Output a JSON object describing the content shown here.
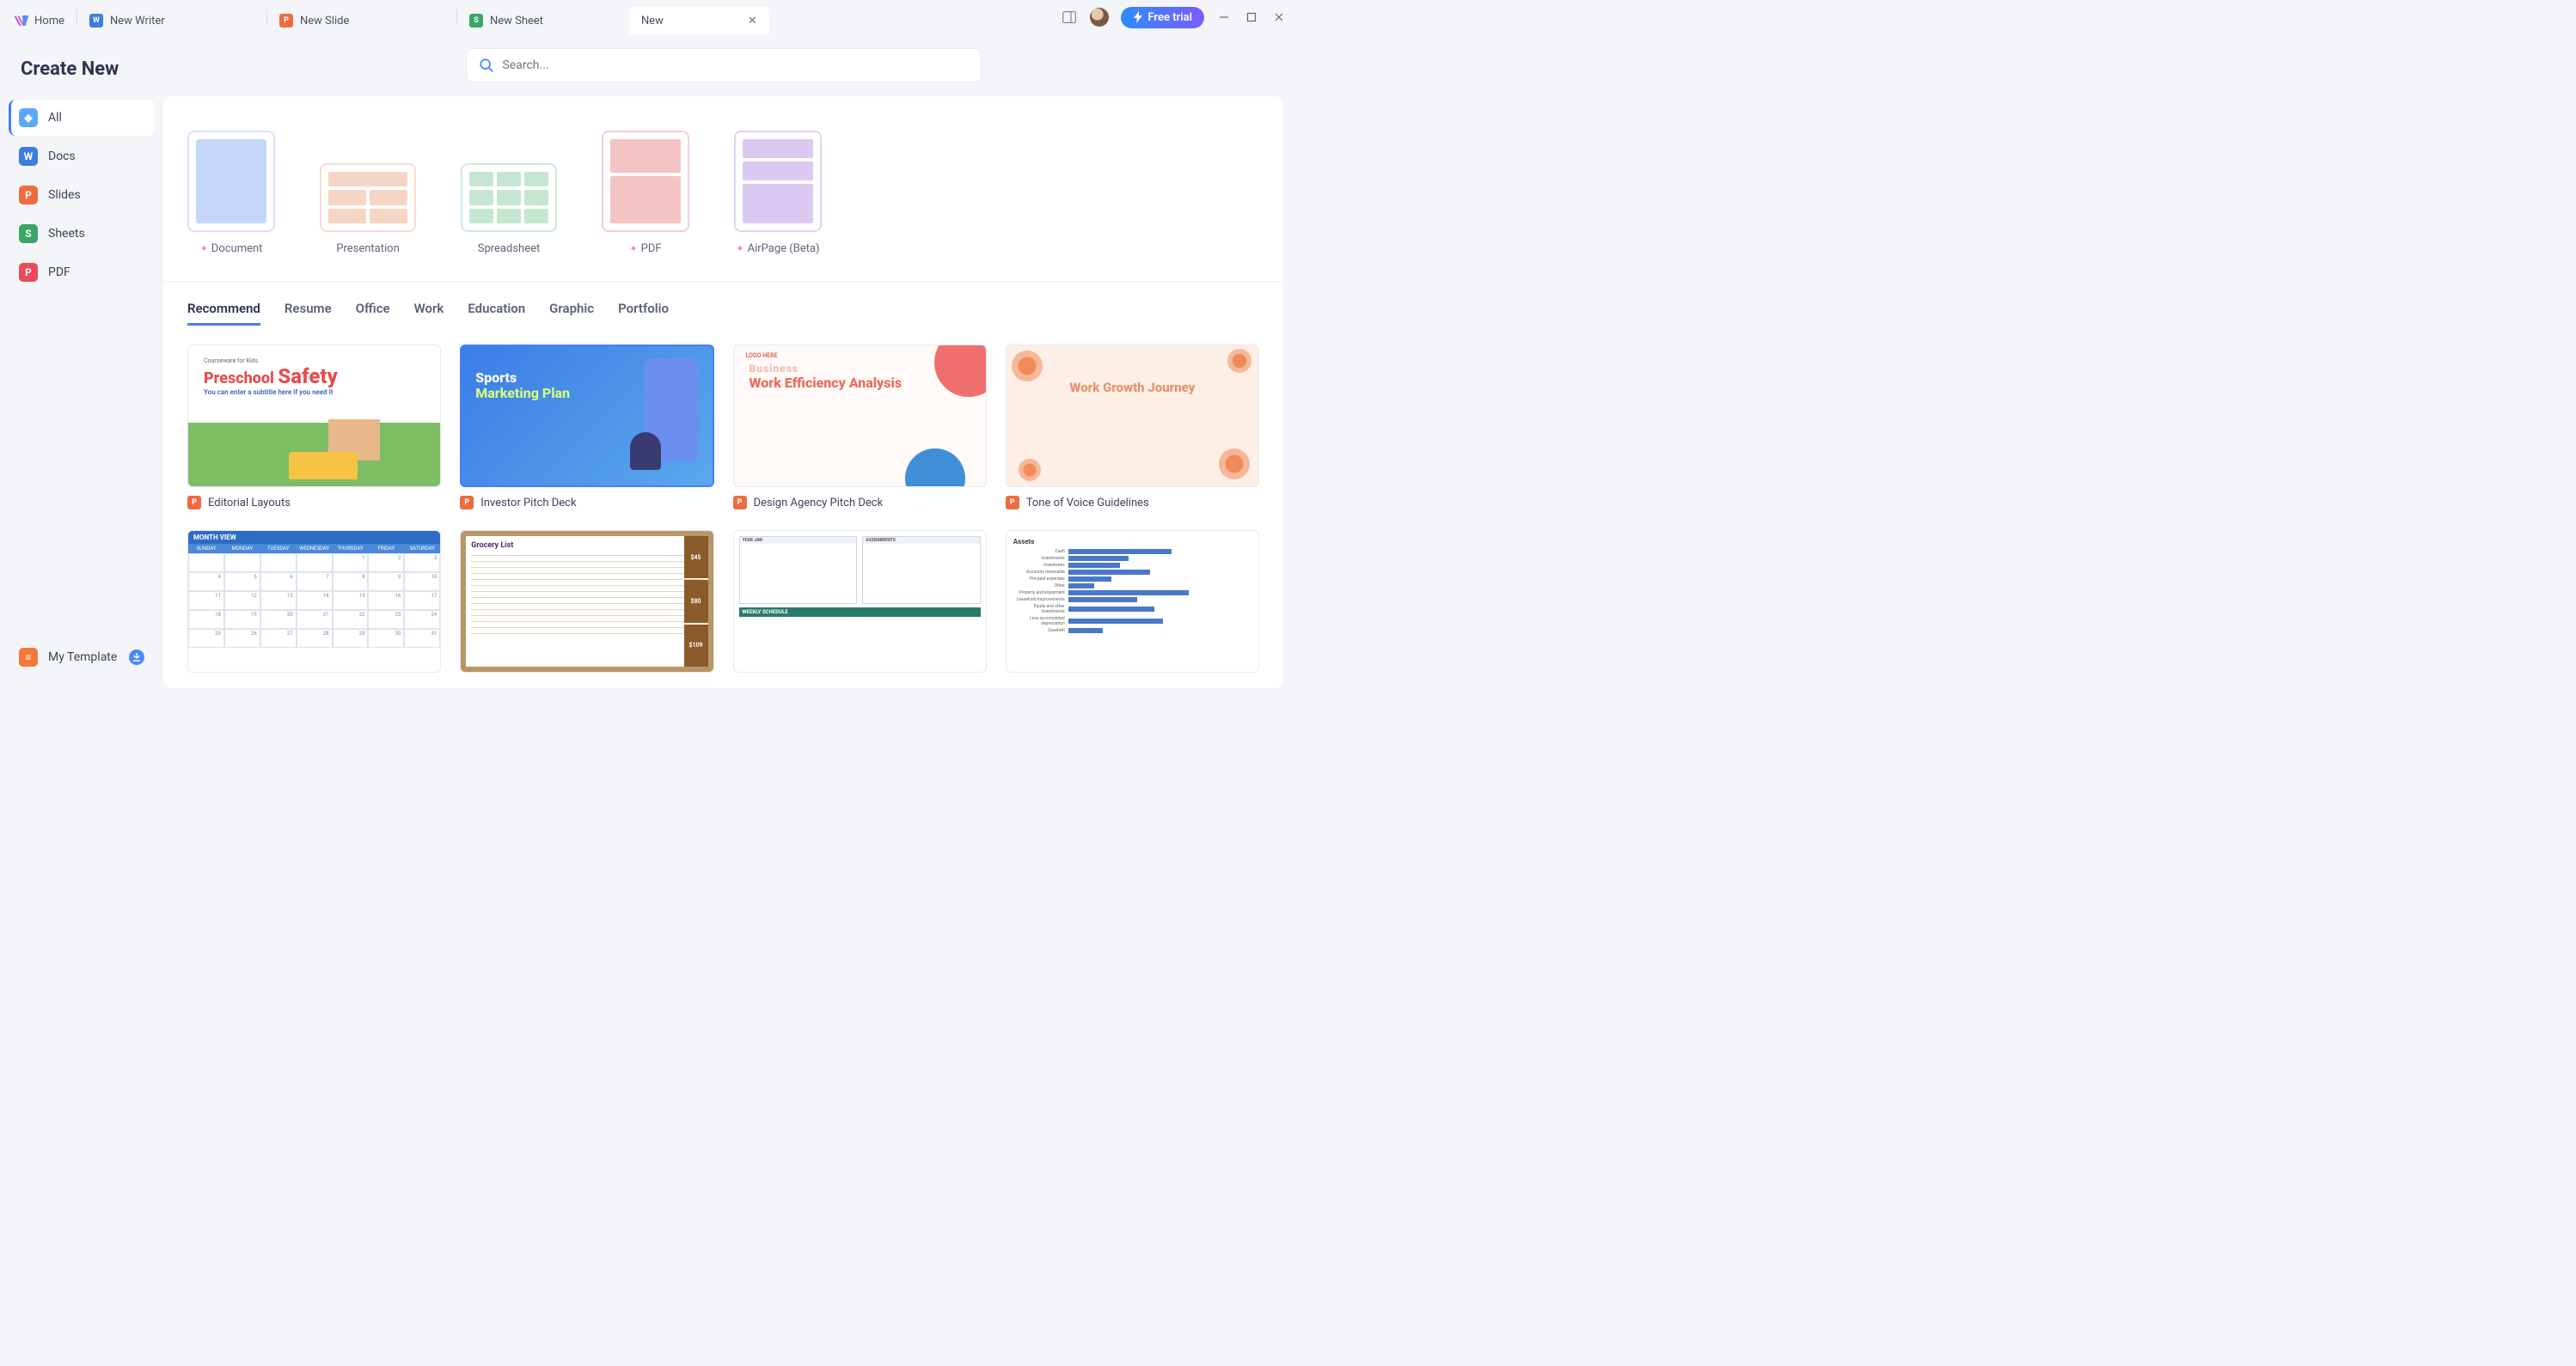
{
  "titlebar": {
    "tabs": [
      {
        "label": "Home",
        "icon": "logo"
      },
      {
        "label": "New Writer",
        "icon": "writer"
      },
      {
        "label": "New Slide",
        "icon": "slide"
      },
      {
        "label": "New Sheet",
        "icon": "sheet"
      },
      {
        "label": "New",
        "icon": "",
        "active": true,
        "closable": true
      }
    ],
    "free_trial": "Free trial"
  },
  "page_title": "Create New",
  "search": {
    "placeholder": "Search..."
  },
  "sidebar": {
    "items": [
      {
        "label": "All",
        "color": "#5aa9f7",
        "glyph": "◆"
      },
      {
        "label": "Docs",
        "color": "#3f7de0",
        "glyph": "W"
      },
      {
        "label": "Slides",
        "color": "#ee6b3f",
        "glyph": "P"
      },
      {
        "label": "Sheets",
        "color": "#3aa768",
        "glyph": "S"
      },
      {
        "label": "PDF",
        "color": "#ea4a5a",
        "glyph": "P"
      }
    ],
    "footer": {
      "label": "My Template",
      "color": "#f07a3a",
      "glyph": "≡"
    }
  },
  "new_docs": [
    {
      "label": "Document",
      "sparkle": true
    },
    {
      "label": "Presentation"
    },
    {
      "label": "Spreadsheet"
    },
    {
      "label": "PDF",
      "sparkle": true
    },
    {
      "label": "AirPage (Beta)",
      "sparkle": true
    }
  ],
  "content_tabs": [
    "Recommend",
    "Resume",
    "Office",
    "Work",
    "Education",
    "Graphic",
    "Portfolio"
  ],
  "active_content_tab": "Recommend",
  "templates": [
    {
      "title": "Editorial Layouts",
      "type": "slide",
      "thumb": "t1",
      "text1": "Preschool",
      "text2": "Safety",
      "text3": "Courseware for Kids"
    },
    {
      "title": "Investor Pitch Deck",
      "type": "slide",
      "thumb": "t2",
      "text1": "Sports",
      "text2": "Marketing Plan"
    },
    {
      "title": "Design Agency Pitch Deck",
      "type": "slide",
      "thumb": "t3",
      "text0": "LOGO HERE",
      "text1": "Business",
      "text2": "Work Efficiency Analysis"
    },
    {
      "title": "Tone of Voice Guidelines",
      "type": "slide",
      "thumb": "t4",
      "text1": "Work Growth Journey"
    },
    {
      "title": "",
      "type": "sheet",
      "thumb": "t5",
      "text1": "MONTH VIEW",
      "days": [
        "SUNDAY",
        "MONDAY",
        "TUESDAY",
        "WEDNESDAY",
        "THURSDAY",
        "FRIDAY",
        "SATURDAY"
      ]
    },
    {
      "title": "",
      "type": "sheet",
      "thumb": "t6",
      "text1": "Grocery List",
      "boxes": [
        "$45",
        "$80",
        "$109"
      ]
    },
    {
      "title": "",
      "type": "sheet",
      "thumb": "t7",
      "text1": "YEAR",
      "text2": "JAN",
      "text3": "ASSIGNMENTS",
      "text4": "WEEKLY SCHEDULE"
    },
    {
      "title": "",
      "type": "sheet",
      "thumb": "t8",
      "text1": "Assets",
      "rows": [
        "Cash",
        "Investments",
        "Inventories",
        "Accounts receivable",
        "Pre-paid expenses",
        "Other",
        "Property and equipment",
        "Leasehold improvements",
        "Equity and other investments",
        "Less accumulated depreciation",
        "Goodwill"
      ]
    }
  ],
  "type_colors": {
    "slide": "#ee6b3f",
    "sheet": "#3aa768"
  },
  "type_glyphs": {
    "slide": "P",
    "sheet": "S"
  }
}
